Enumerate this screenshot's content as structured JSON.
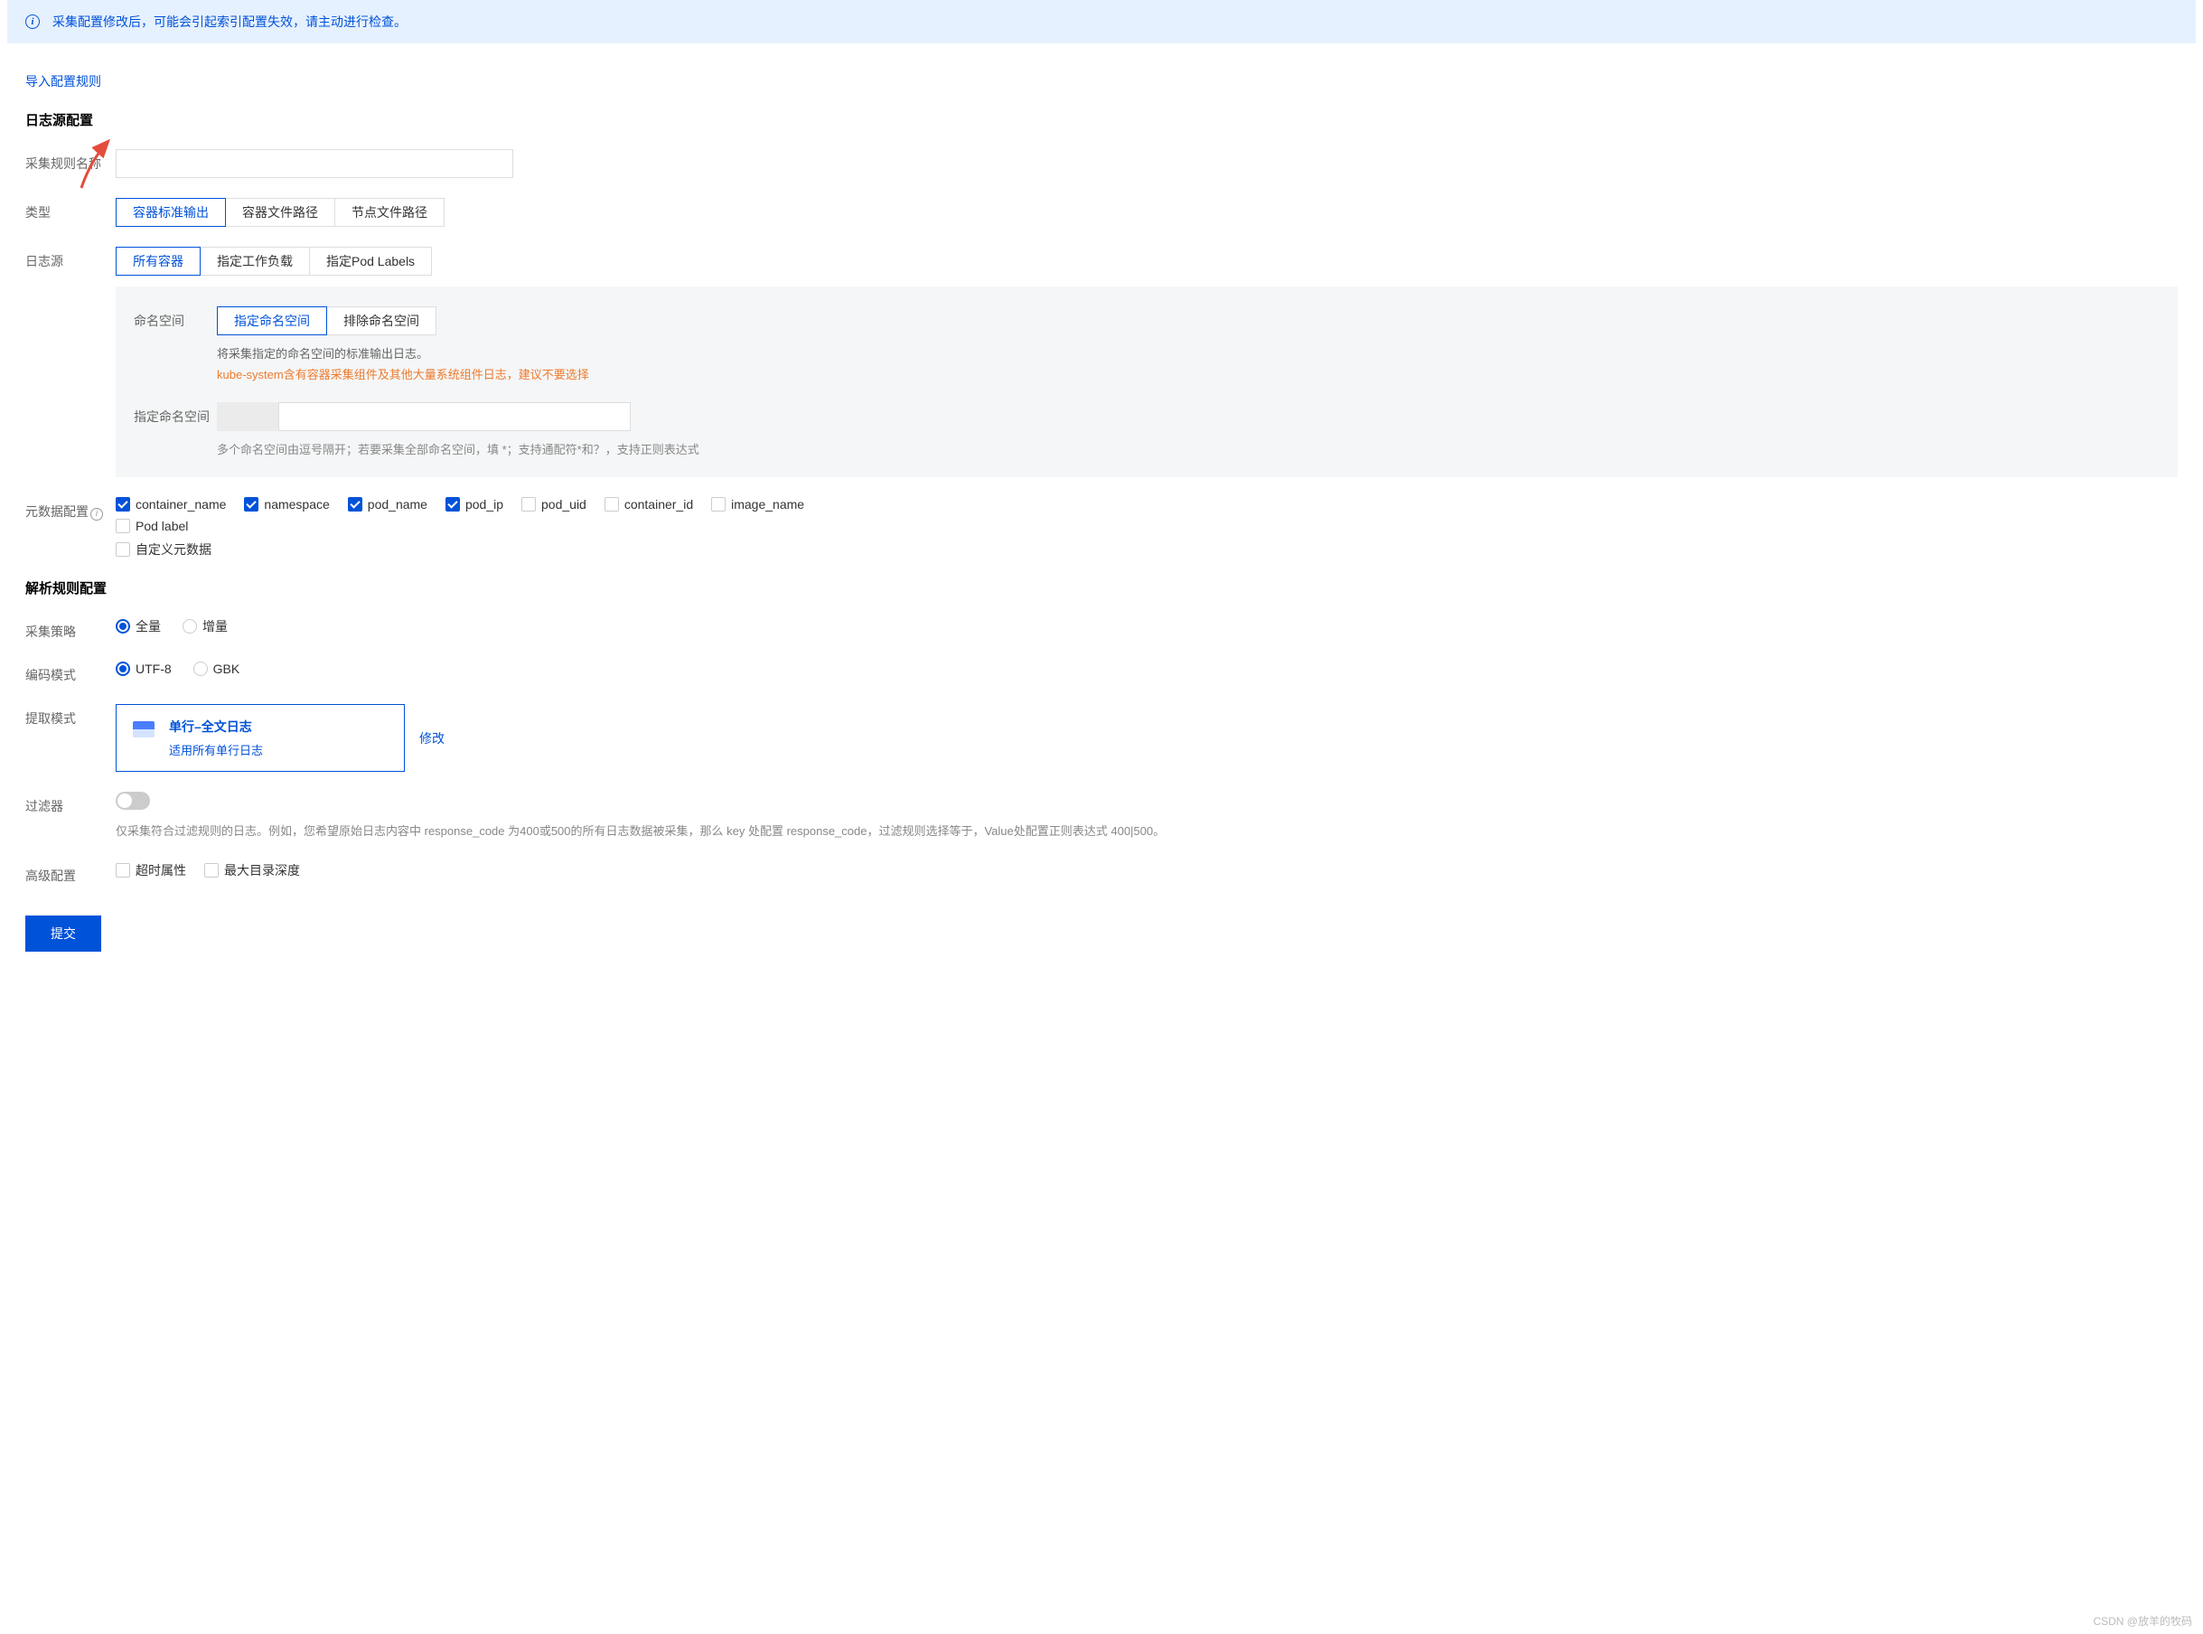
{
  "banner": {
    "text": "采集配置修改后，可能会引起索引配置失效，请主动进行检查。"
  },
  "importLink": "导入配置规则",
  "section1Title": "日志源配置",
  "ruleName": {
    "label": "采集规则名称",
    "value": ""
  },
  "type": {
    "label": "类型",
    "options": [
      "容器标准输出",
      "容器文件路径",
      "节点文件路径"
    ],
    "selected": 0
  },
  "logSource": {
    "label": "日志源",
    "options": [
      "所有容器",
      "指定工作负载",
      "指定Pod Labels"
    ],
    "selected": 0
  },
  "namespace": {
    "label": "命名空间",
    "options": [
      "指定命名空间",
      "排除命名空间"
    ],
    "selected": 0,
    "hint1": "将采集指定的命名空间的标准输出日志。",
    "hint2": "kube-system含有容器采集组件及其他大量系统组件日志，建议不要选择"
  },
  "specNamespace": {
    "label": "指定命名空间",
    "value": "",
    "help": "多个命名空间由逗号隔开；若要采集全部命名空间，填 *；支持通配符*和？，支持正则表达式"
  },
  "metadata": {
    "label": "元数据配置",
    "row1": [
      {
        "label": "container_name",
        "checked": true
      },
      {
        "label": "namespace",
        "checked": true
      },
      {
        "label": "pod_name",
        "checked": true
      },
      {
        "label": "pod_ip",
        "checked": true
      },
      {
        "label": "pod_uid",
        "checked": false
      },
      {
        "label": "container_id",
        "checked": false
      },
      {
        "label": "image_name",
        "checked": false
      }
    ],
    "row2": [
      {
        "label": "Pod label",
        "checked": false
      }
    ],
    "row3": [
      {
        "label": "自定义元数据",
        "checked": false
      }
    ]
  },
  "section2Title": "解析规则配置",
  "strategy": {
    "label": "采集策略",
    "options": [
      "全量",
      "增量"
    ],
    "selected": 0
  },
  "encoding": {
    "label": "编码模式",
    "options": [
      "UTF-8",
      "GBK"
    ],
    "selected": 0
  },
  "extractMode": {
    "label": "提取模式",
    "title": "单行–全文日志",
    "desc": "适用所有单行日志",
    "modifyLabel": "修改"
  },
  "filter": {
    "label": "过滤器",
    "help": "仅采集符合过滤规则的日志。例如，您希望原始日志内容中 response_code 为400或500的所有日志数据被采集，那么 key 处配置 response_code，过滤规则选择等于，Value处配置正则表达式 400|500。"
  },
  "advanced": {
    "label": "高级配置",
    "options": [
      {
        "label": "超时属性",
        "checked": false
      },
      {
        "label": "最大目录深度",
        "checked": false
      }
    ]
  },
  "submit": "提交",
  "watermark": "CSDN @放羊的牧码"
}
